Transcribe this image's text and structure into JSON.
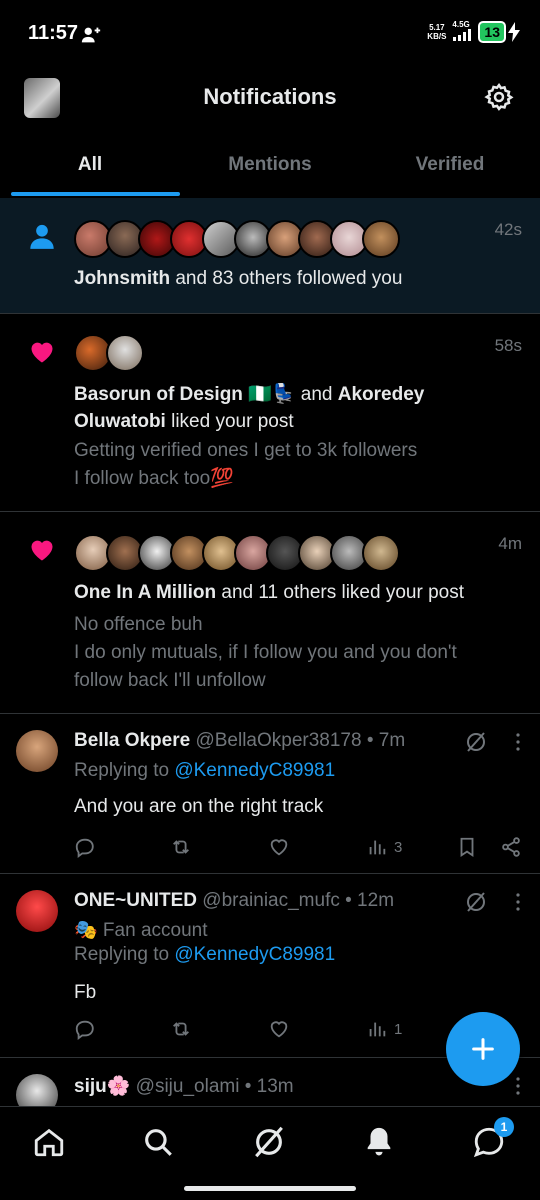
{
  "status_bar": {
    "time": "11:57",
    "speed_value": "5.17",
    "speed_unit": "KB/S",
    "network": "4.5G",
    "battery": "13"
  },
  "header": {
    "title": "Notifications"
  },
  "tabs": [
    {
      "label": "All",
      "active": true
    },
    {
      "label": "Mentions",
      "active": false
    },
    {
      "label": "Verified",
      "active": false
    }
  ],
  "notifications": [
    {
      "type": "follow",
      "time": "42s",
      "actor": "Johnsmith",
      "rest": " and 83 others followed you"
    },
    {
      "type": "like",
      "time": "58s",
      "actor": "Basorun of Design 🇳🇬💺",
      "connector": " and ",
      "actor2": "Akoredey Oluwatobi",
      "rest": " liked your post",
      "post_line1": "Getting verified ones I get to 3k followers",
      "post_line2": "I follow back too💯"
    },
    {
      "type": "like",
      "time": "4m",
      "actor": "One In A Million",
      "rest": " and 11 others liked your post",
      "post_line1": "No offence buh",
      "post_line2": "I do only mutuals, if I follow you and you don't",
      "post_line3": "follow back I'll unfollow"
    }
  ],
  "tweets": [
    {
      "name": "Bella Okpere",
      "handle": "@BellaOkper38178 • 7m",
      "replying_prefix": "Replying to ",
      "replying_to": "@KennedyC89981",
      "body": "And you are on the right track",
      "views": "3"
    },
    {
      "name": "ONE~UNITED",
      "handle": "@brainiac_mufc • 12m",
      "label": "🎭 Fan account",
      "replying_prefix": "Replying to ",
      "replying_to": "@KennedyC89981",
      "body": "Fb",
      "views": "1"
    },
    {
      "name": "siju🌸",
      "handle": "@siju_olami • 13m"
    }
  ],
  "bottom_nav": {
    "messages_badge": "1"
  },
  "colors": {
    "accent": "#1d9bf0",
    "like": "#f91880",
    "muted": "#71767b",
    "highlight_bg": "#0b1a24"
  }
}
